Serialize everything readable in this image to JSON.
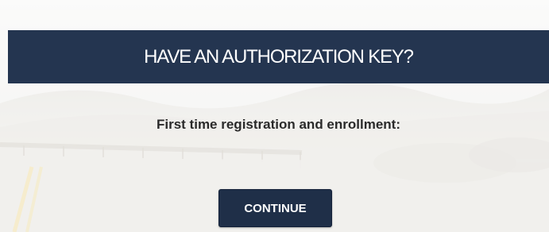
{
  "header": {
    "title": "HAVE AN AUTHORIZATION KEY?"
  },
  "main": {
    "subtitle": "First time registration and enrollment:",
    "continue_label": "CONTINUE"
  },
  "colors": {
    "header_bg": "#243550",
    "button_bg": "#1f2f48",
    "text_dark": "#2a2a2a"
  }
}
